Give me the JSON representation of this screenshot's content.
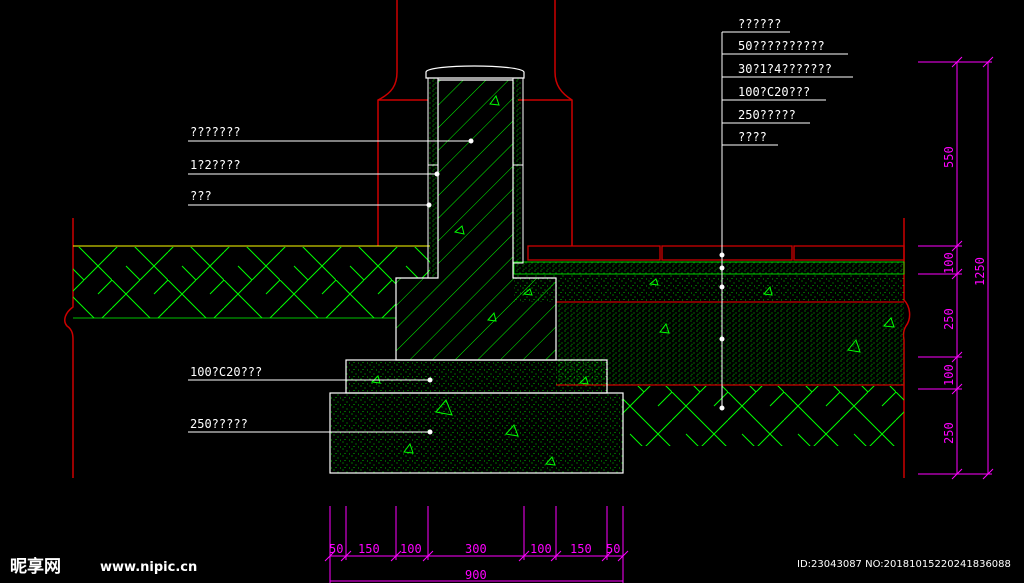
{
  "left_labels": [
    "???????",
    "1?2????",
    "???",
    "100?C20???",
    "250?????"
  ],
  "right_labels": [
    "??????",
    "50??????????",
    "30?1?4???????",
    "100?C20???",
    "250?????",
    "????"
  ],
  "vertical_dims": [
    "550",
    "100",
    "250",
    "100",
    "250"
  ],
  "vertical_total": "1250",
  "horizontal_dims": [
    "50",
    "150",
    "100",
    "300",
    "100",
    "150",
    "50"
  ],
  "horizontal_total": "900",
  "watermark": {
    "logo_text": "昵享网",
    "url": "www.nipic.cn",
    "id_text": "ID:23043087 NO:20181015220241836088"
  },
  "colors": {
    "background": "#000000",
    "outline": "#ffffff",
    "hatch": "#00ff00",
    "brick": "#cc0000",
    "dimension": "#ff00ff",
    "ground_line": "#ffff00"
  }
}
